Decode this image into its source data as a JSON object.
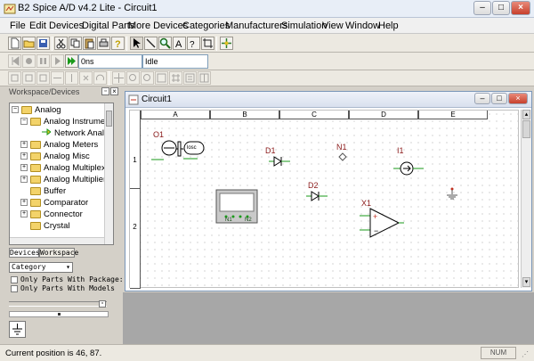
{
  "window": {
    "title": "B2 Spice A/D v4.2 Lite - Circuit1"
  },
  "menu": [
    "File",
    "Edit",
    "Devices",
    "Digital Parts",
    "More Devices",
    "Categories",
    "Manufacturers",
    "Simulation",
    "View",
    "Window",
    "Help"
  ],
  "simulation": {
    "time_value": "0ns",
    "status": "Idle"
  },
  "workspace": {
    "title": "Workspace/Devices",
    "tree": [
      {
        "label": "Analog",
        "level": 0,
        "expanded": true
      },
      {
        "label": "Analog Instrumen",
        "level": 1,
        "expanded": true
      },
      {
        "label": "Network Anal",
        "level": 2,
        "leaf": true
      },
      {
        "label": "Analog Meters",
        "level": 1
      },
      {
        "label": "Analog Misc",
        "level": 1
      },
      {
        "label": "Analog Multiplex",
        "level": 1
      },
      {
        "label": "Analog Multiplier",
        "level": 1
      },
      {
        "label": "Buffer",
        "level": 1
      },
      {
        "label": "Comparator",
        "level": 1
      },
      {
        "label": "Connector",
        "level": 1
      },
      {
        "label": "Crystal",
        "level": 1
      }
    ],
    "tabs": [
      "Devices",
      "Workspace"
    ],
    "category_select": "Category",
    "checkbox_packages": "Only Parts With Package:",
    "checkbox_models": "Only Parts With Models"
  },
  "circuit": {
    "title": "Circuit1",
    "columns": [
      "A",
      "B",
      "C",
      "D",
      "E"
    ],
    "rows": [
      "1",
      "2"
    ],
    "parts": {
      "o1": "O1",
      "d1": "D1",
      "n1": "N1",
      "i1": "I1",
      "d2": "D2",
      "x1": "X1",
      "meter_n1": "N1",
      "meter_n2": "N2",
      "osc_text": "losc"
    }
  },
  "status": {
    "text": "Current position is 46, 87.",
    "right": "NUM"
  },
  "colors": {
    "part_red": "#8b1a1a",
    "wire_green": "#1a9a1a",
    "sheet_dots": "#b9b9b9"
  }
}
